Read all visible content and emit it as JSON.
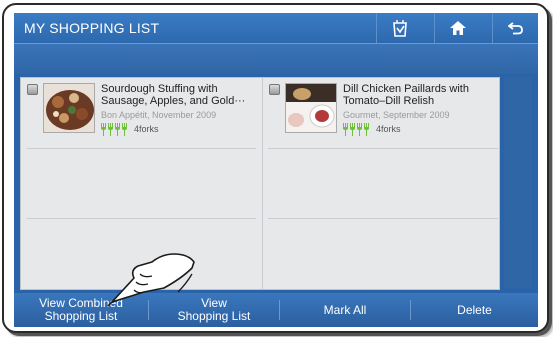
{
  "header": {
    "title": "MY SHOPPING LIST",
    "icons": [
      "shopping-bag-icon",
      "home-icon",
      "back-icon"
    ]
  },
  "items": [
    {
      "title": "Sourdough Stuffing with Sausage, Apples, and Gold···",
      "source": "Bon Appétit, November 2009",
      "rating": 4,
      "rating_label": "4forks"
    },
    {
      "title": "Dill Chicken Paillards with Tomato–Dill Relish",
      "source": "Gourmet, September 2009",
      "rating": 4,
      "rating_label": "4forks"
    }
  ],
  "bottom_bar": {
    "view_combined": "View Combined\nShopping List",
    "view_shopping": "View\nShopping List",
    "mark_all": "Mark All",
    "delete": "Delete"
  },
  "colors": {
    "header_blue": "#2d68ae",
    "fork_green": "#6fbf3a"
  }
}
